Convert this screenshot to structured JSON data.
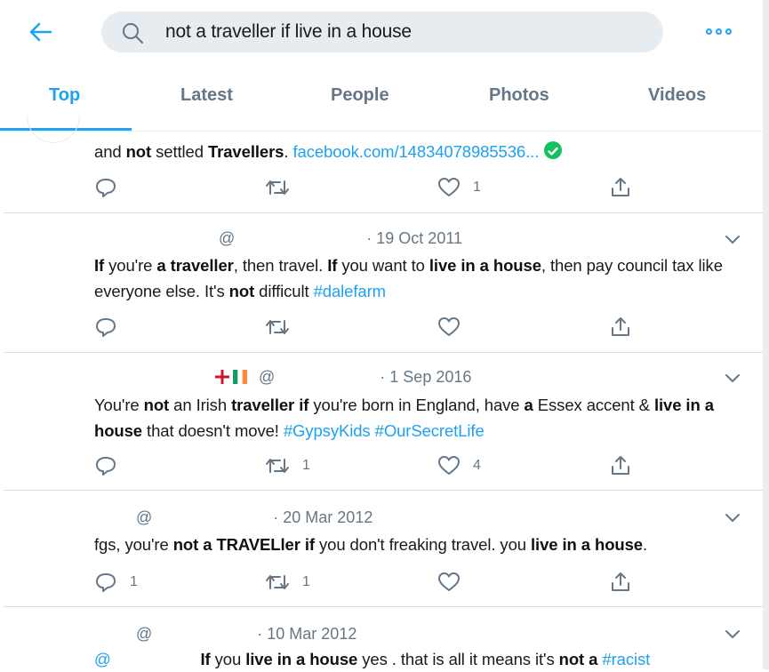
{
  "search": {
    "query": "not a traveller if live in a house"
  },
  "tabs": [
    {
      "label": "Top"
    },
    {
      "label": "Latest"
    },
    {
      "label": "People"
    },
    {
      "label": "Photos"
    },
    {
      "label": "Videos"
    }
  ],
  "colors": {
    "accent": "#1da1f2",
    "muted": "#657786",
    "verified": "#17bf63"
  },
  "tweets": [
    {
      "header": {
        "handle": "",
        "date": ""
      },
      "segments": [
        {
          "t": "and "
        },
        {
          "t": "not",
          "b": true
        },
        {
          "t": " settled "
        },
        {
          "t": "Travellers",
          "b": true
        },
        {
          "t": ". "
        },
        {
          "t": "facebook.com/14834078985536...",
          "link": true
        }
      ],
      "actions": {
        "reply": "",
        "retweet": "",
        "like": "1"
      }
    },
    {
      "header": {
        "handle": "@",
        "date": "· 19 Oct 2011"
      },
      "segments": [
        {
          "t": "If",
          "b": true
        },
        {
          "t": " you're "
        },
        {
          "t": "a traveller",
          "b": true
        },
        {
          "t": ", then travel. "
        },
        {
          "t": "If",
          "b": true
        },
        {
          "t": " you want to "
        },
        {
          "t": "live in a house",
          "b": true
        },
        {
          "t": ", then pay council tax like everyone else. It's "
        },
        {
          "t": "not",
          "b": true
        },
        {
          "t": " difficult "
        },
        {
          "t": "#dalefarm",
          "link": true
        }
      ],
      "actions": {
        "reply": "",
        "retweet": "",
        "like": ""
      }
    },
    {
      "header": {
        "handle": "@",
        "date": "· 1 Sep 2016"
      },
      "segments": [
        {
          "t": "You're "
        },
        {
          "t": "not",
          "b": true
        },
        {
          "t": " an Irish "
        },
        {
          "t": "traveller if",
          "b": true
        },
        {
          "t": " you're born in England, have "
        },
        {
          "t": "a",
          "b": true
        },
        {
          "t": " Essex accent & "
        },
        {
          "t": "live in a house",
          "b": true
        },
        {
          "t": " that doesn't move! "
        },
        {
          "t": "#GypsyKids",
          "link": true
        },
        {
          "t": " "
        },
        {
          "t": "#OurSecretLife",
          "link": true
        }
      ],
      "actions": {
        "reply": "",
        "retweet": "1",
        "like": "4"
      }
    },
    {
      "header": {
        "handle": "@",
        "date": "· 20 Mar 2012"
      },
      "segments": [
        {
          "t": "fgs, you're "
        },
        {
          "t": "not a TRAVELler if",
          "b": true
        },
        {
          "t": " you don't freaking travel. you "
        },
        {
          "t": "live in a house",
          "b": true
        },
        {
          "t": "."
        }
      ],
      "actions": {
        "reply": "1",
        "retweet": "1",
        "like": ""
      }
    },
    {
      "header": {
        "handle": "@",
        "date": "· 10 Mar 2012"
      },
      "segments": [
        {
          "t": "@",
          "link": true
        },
        {
          "t": "                    "
        },
        {
          "t": "If",
          "b": true
        },
        {
          "t": " you "
        },
        {
          "t": "live in a house",
          "b": true
        },
        {
          "t": " yes . that is all it means it's "
        },
        {
          "t": "not a",
          "b": true
        },
        {
          "t": " "
        },
        {
          "t": "#racist",
          "link": true
        }
      ],
      "actions": {
        "reply": "",
        "retweet": "",
        "like": ""
      }
    }
  ]
}
